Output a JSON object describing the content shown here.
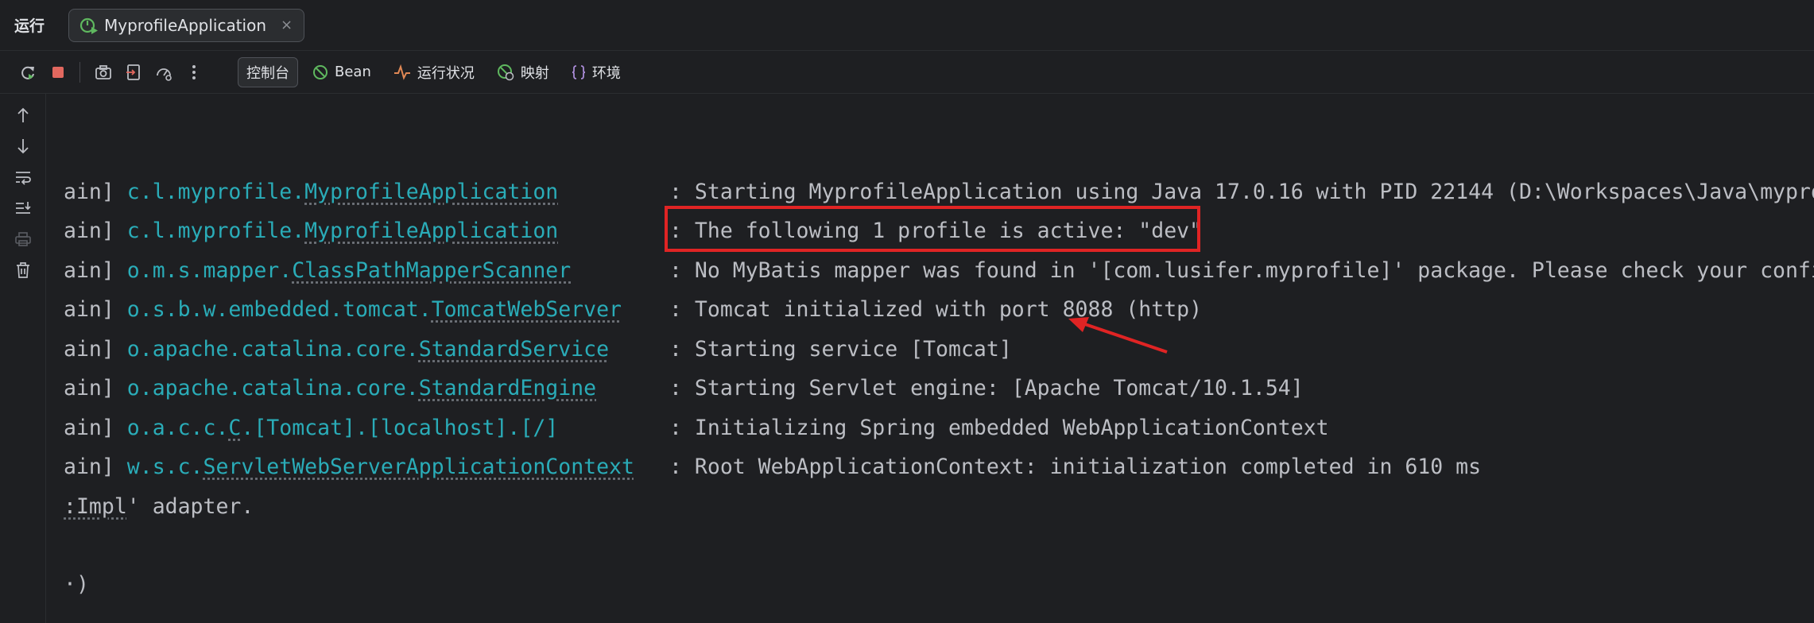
{
  "tabbar": {
    "run_label": "运行",
    "tab_title": "MyprofileApplication",
    "close_glyph": "×"
  },
  "toolbar": {
    "icons": [
      "rerun-icon",
      "stop-icon",
      "camera-icon",
      "exit-icon",
      "gauge-icon",
      "more-icon"
    ],
    "tabs": [
      {
        "label": "控制台",
        "icon": "",
        "active": true
      },
      {
        "label": "Bean",
        "icon": "bean-icon",
        "active": false
      },
      {
        "label": "运行状况",
        "icon": "pulse-icon",
        "active": false
      },
      {
        "label": "映射",
        "icon": "mapping-icon",
        "active": false
      },
      {
        "label": "环境",
        "icon": "braces-icon",
        "active": false
      }
    ]
  },
  "side_icons": [
    "arrow-up-icon",
    "arrow-down-icon",
    "soft-wrap-icon",
    "scroll-end-icon",
    "print-icon",
    "trash-icon"
  ],
  "console": {
    "lines": [
      {
        "prefix": "ain] ",
        "logger_pkg": "c.l.myprofile.",
        "logger_cls": "MyprofileApplication",
        "message": ": Starting MyprofileApplication using Java 17.0.16 with PID 22144 (D:\\Workspaces\\Java\\myprof"
      },
      {
        "prefix": "ain] ",
        "logger_pkg": "c.l.myprofile.",
        "logger_cls": "MyprofileApplication",
        "message": ": The following 1 profile is active: \"dev\""
      },
      {
        "prefix": "ain] ",
        "logger_pkg": "o.m.s.mapper.",
        "logger_cls": "ClassPathMapperScanner",
        "message": ": No MyBatis mapper was found in '[com.lusifer.myprofile]' package. Please check your config"
      },
      {
        "prefix": "ain] ",
        "logger_pkg": "o.s.b.w.embedded.tomcat.",
        "logger_cls": "TomcatWebServer",
        "message": ": Tomcat initialized with port 8088 (http)"
      },
      {
        "prefix": "ain] ",
        "logger_pkg": "o.apache.catalina.core.",
        "logger_cls": "StandardService",
        "message": ": Starting service [Tomcat]"
      },
      {
        "prefix": "ain] ",
        "logger_pkg": "o.apache.catalina.core.",
        "logger_cls": "StandardEngine",
        "message": ": Starting Servlet engine: [Apache Tomcat/10.1.54]"
      },
      {
        "prefix": "ain] ",
        "logger_pkg": "o.a.c.c.",
        "logger_cls": "C",
        "logger_tail": ".[Tomcat].[localhost].[/]",
        "message": ": Initializing Spring embedded WebApplicationContext"
      },
      {
        "prefix": "ain] ",
        "logger_pkg": "w.s.c.",
        "logger_cls": "ServletWebServerApplicationContext",
        "message": ": Root WebApplicationContext: initialization completed in 610 ms"
      }
    ],
    "tail1_ul": ":Impl",
    "tail1_rest": "' adapter.",
    "tail2": "·)"
  },
  "colors": {
    "background": "#1e1f22",
    "logger": "#2aacb8",
    "highlight": "#e02424"
  }
}
